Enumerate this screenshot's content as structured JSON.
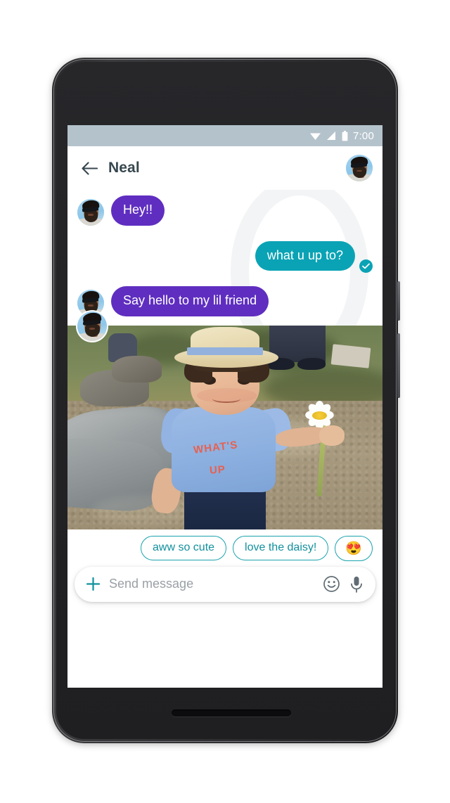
{
  "device": {
    "name": "android-phone",
    "hardware": {
      "front_camera": "front-camera-icon",
      "earpiece": "earpiece-speaker",
      "bottom_speaker": "bottom-speaker",
      "power_button": "power-button",
      "volume_button": "volume-button"
    }
  },
  "status_bar": {
    "time": "7:00",
    "icons": [
      "wifi-icon",
      "signal-icon",
      "battery-icon"
    ],
    "background": "#b4c2cb",
    "foreground": "#ffffff"
  },
  "app_bar": {
    "back_icon": "back-arrow-icon",
    "title": "Neal",
    "avatar": "contact-avatar"
  },
  "conversation": {
    "messages": [
      {
        "id": "msg-1",
        "direction": "incoming",
        "text": "Hey!!",
        "avatar": true
      },
      {
        "id": "msg-2",
        "direction": "outgoing",
        "text": "what u up to?",
        "status": "delivered"
      },
      {
        "id": "msg-3",
        "direction": "incoming",
        "text": "Say hello to my lil friend",
        "avatar": true
      },
      {
        "id": "msg-4",
        "direction": "incoming",
        "type": "photo",
        "alt": "toddler in straw hat holding a daisy",
        "avatar": true
      }
    ],
    "bubble_colors": {
      "incoming": "#5f2ec0",
      "outgoing": "#0aa3b5"
    }
  },
  "suggestions": {
    "chips": [
      {
        "id": "chip-1",
        "label": "aww so cute"
      },
      {
        "id": "chip-2",
        "label": "love the daisy!"
      },
      {
        "id": "chip-3",
        "label": "😍"
      }
    ],
    "accent": "#12909c"
  },
  "composer": {
    "plus_icon": "plus-icon",
    "placeholder": "Send message",
    "value": "",
    "emoji_icon": "emoji-icon",
    "mic_icon": "microphone-icon"
  },
  "nav_bar": {
    "back": "nav-back-icon",
    "home": "nav-home-icon",
    "recents": "nav-recents-icon"
  }
}
